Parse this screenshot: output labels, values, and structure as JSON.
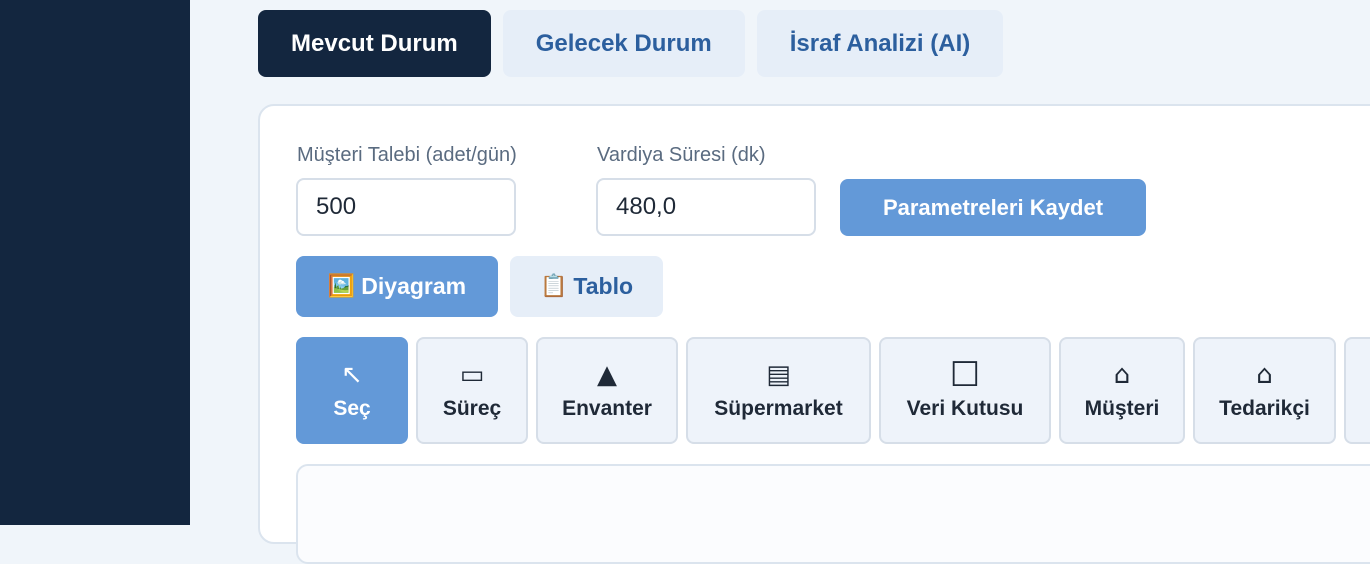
{
  "tabs": [
    {
      "label": "Mevcut Durum",
      "active": true
    },
    {
      "label": "Gelecek Durum",
      "active": false
    },
    {
      "label": "İsraf Analizi (AI)",
      "active": false
    }
  ],
  "params": {
    "demand_label": "Müşteri Talebi (adet/gün)",
    "demand_value": "500",
    "shift_label": "Vardiya Süresi (dk)",
    "shift_value": "480,0",
    "save_label": "Parametreleri Kaydet"
  },
  "views": [
    {
      "label": "Diyagram",
      "icon": "🖼️",
      "icon_name": "picture-icon",
      "active": true
    },
    {
      "label": "Tablo",
      "icon": "📋",
      "icon_name": "clipboard-icon",
      "active": false
    }
  ],
  "tools": [
    {
      "label": "Seç",
      "icon": "↖",
      "icon_name": "select-arrow-icon",
      "active": true
    },
    {
      "label": "Süreç",
      "icon": "▭",
      "icon_name": "process-rectangle-icon",
      "active": false
    },
    {
      "label": "Envanter",
      "icon": "▲",
      "icon_name": "inventory-triangle-icon",
      "active": false
    },
    {
      "label": "Süpermarket",
      "icon": "▤",
      "icon_name": "supermarket-icon",
      "active": false
    },
    {
      "label": "Veri Kutusu",
      "icon": "☐",
      "icon_name": "data-box-icon",
      "active": false
    },
    {
      "label": "Müşteri",
      "icon": "⌂",
      "icon_name": "customer-factory-icon",
      "active": false
    },
    {
      "label": "Tedarikçi",
      "icon": "⌂",
      "icon_name": "supplier-factory-icon",
      "active": false
    }
  ],
  "colors": {
    "sidebar": "#13263f",
    "accent": "#6399d8",
    "tab_text": "#2c5f9e"
  }
}
